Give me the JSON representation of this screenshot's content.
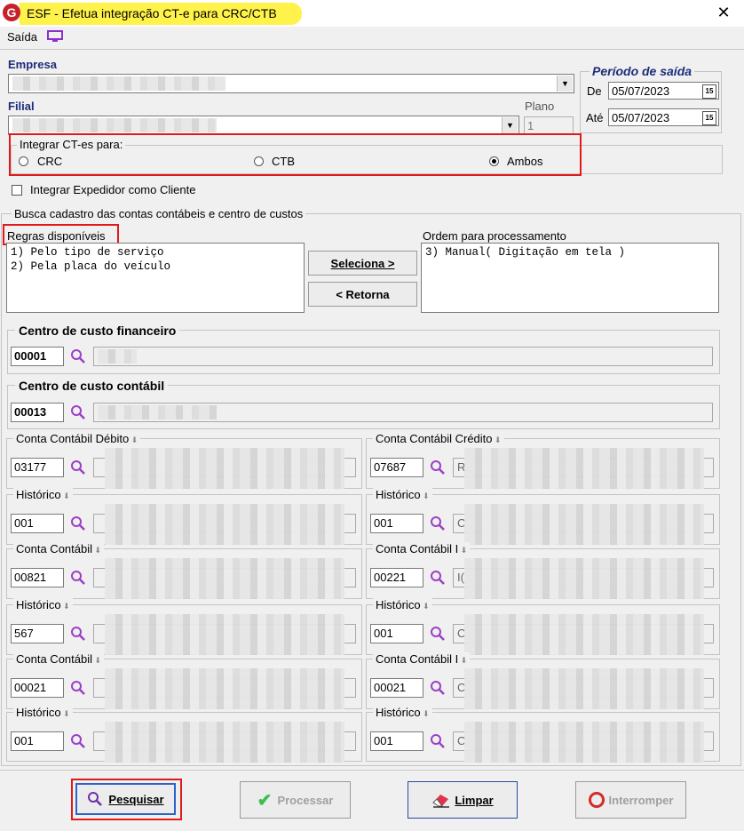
{
  "window": {
    "title": "ESF - Efetua integração CT-e para CRC/CTB",
    "close_label": "✕"
  },
  "menu": {
    "saida_label": "Saída"
  },
  "empresa": {
    "label": "Empresa",
    "value": ""
  },
  "filial": {
    "label": "Filial",
    "value": ""
  },
  "plano": {
    "label": "Plano",
    "value": "1"
  },
  "periodo": {
    "title": "Período de saída",
    "de_label": "De",
    "de_value": "05/07/2023",
    "ate_label": "Até",
    "ate_value": "05/07/2023",
    "date_btn": "15"
  },
  "integrar": {
    "title": "Integrar CT-es para:",
    "options": [
      "CRC",
      "CTB",
      "Ambos"
    ],
    "selected": "Ambos"
  },
  "expedidor": {
    "label": "Integrar Expedidor como Cliente",
    "checked": false
  },
  "busca": {
    "title": "Busca cadastro das contas contábeis e centro de custos"
  },
  "regras": {
    "label": "Regras disponíveis",
    "items": [
      "1) Pelo tipo de serviço",
      "2) Pela placa do veículo"
    ]
  },
  "ordem": {
    "label": "Ordem para processamento",
    "items": [
      "3) Manual( Digitação em tela )"
    ]
  },
  "buttons_mid": {
    "seleciona": "Seleciona >",
    "retorna": "< Retorna"
  },
  "cc_financeiro": {
    "title": "Centro de custo financeiro",
    "code": "00001"
  },
  "cc_contabil": {
    "title": "Centro de custo contábil",
    "code": "00013"
  },
  "left_groups": [
    {
      "title": "Conta Contábil Débito",
      "code": "03177"
    },
    {
      "title": "Histórico",
      "code": "001"
    },
    {
      "title": "Conta Contábil",
      "code": "00821"
    },
    {
      "title": "Histórico",
      "code": "567"
    },
    {
      "title": "Conta Contábil",
      "code": "00021"
    },
    {
      "title": "Histórico",
      "code": "001"
    }
  ],
  "right_groups": [
    {
      "title": "Conta Contábil Crédito",
      "code": "07687",
      "desc_prefix": "R"
    },
    {
      "title": "Histórico",
      "code": "001",
      "desc_prefix": "C"
    },
    {
      "title": "Conta Contábil I",
      "code": "00221",
      "desc_prefix": "I("
    },
    {
      "title": "Histórico",
      "code": "001",
      "desc_prefix": "C"
    },
    {
      "title": "Conta Contábil I",
      "code": "00021",
      "desc_prefix": "C"
    },
    {
      "title": "Histórico",
      "code": "001",
      "desc_prefix": "C"
    }
  ],
  "actions": {
    "pesquisar": "Pesquisar",
    "processar": "Processar",
    "limpar": "Limpar",
    "interromper": "Interromper"
  },
  "colors": {
    "title_highlight": "#fff24a",
    "annotation_red": "#e01a1a",
    "label_blue": "#1c2d7a",
    "search_icon": "#9b3fc7",
    "processar_check": "#3cbf52",
    "interromper_red": "#d42a2a"
  }
}
